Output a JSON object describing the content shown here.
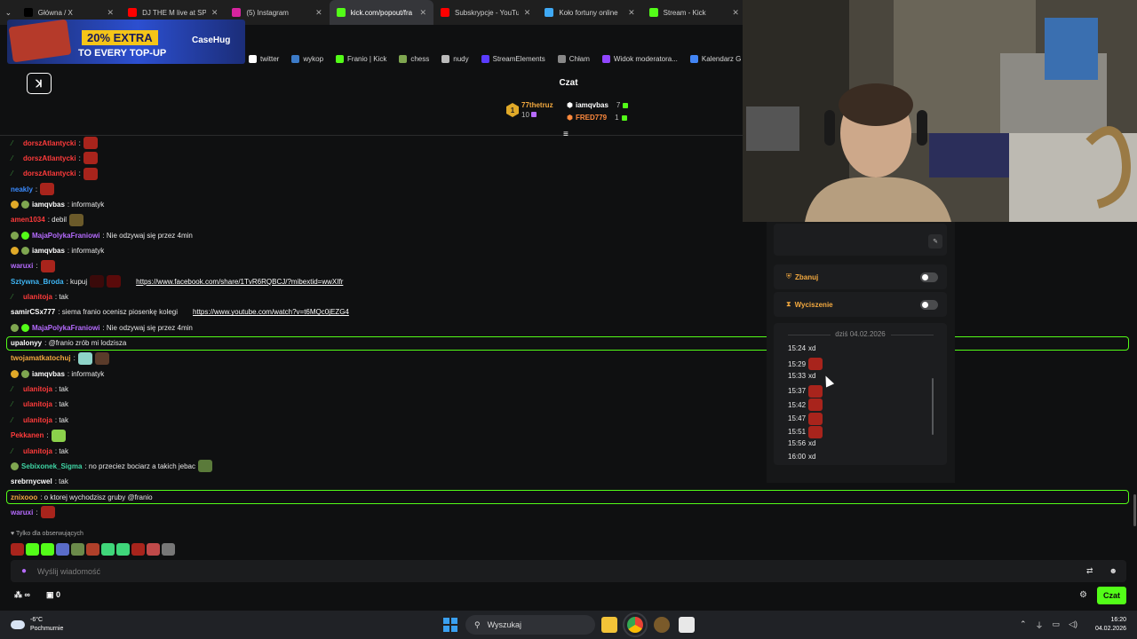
{
  "browser": {
    "tabs": [
      {
        "label": "Główna / X",
        "color": "#000000",
        "active": false
      },
      {
        "label": "DJ THE M live at SPE",
        "color": "#ff0000",
        "active": false
      },
      {
        "label": "(5) Instagram",
        "color": "#d6249f",
        "active": false
      },
      {
        "label": "kick.com/popout/fra",
        "color": "#53fc18",
        "active": true
      },
      {
        "label": "Subskrypcje - YouTu",
        "color": "#ff0000",
        "active": false
      },
      {
        "label": "Koło fortuny online",
        "color": "#3fa9f5",
        "active": false
      },
      {
        "label": "Stream - Kick",
        "color": "#53fc18",
        "active": false
      }
    ],
    "ad": {
      "extra": "20% EXTRA",
      "topup": "TO EVERY TOP-UP",
      "logo": "CaseHug"
    },
    "bookmarks": [
      {
        "label": "twitter",
        "color": "#ffffff"
      },
      {
        "label": "wykop",
        "color": "#3c7bc8"
      },
      {
        "label": "Franio | Kick",
        "color": "#53fc18"
      },
      {
        "label": "chess",
        "color": "#7fa650"
      },
      {
        "label": "nudy",
        "color": "#bbbbbb"
      },
      {
        "label": "StreamElements",
        "color": "#5a3cff"
      },
      {
        "label": "Chłam",
        "color": "#888888"
      },
      {
        "label": "Widok moderatora...",
        "color": "#9146ff"
      },
      {
        "label": "Kalendarz G",
        "color": "#4285f4"
      }
    ]
  },
  "kick": {
    "logo": "ꓘ",
    "chat_title": "Czat",
    "gifters": [
      {
        "rank": "1",
        "name": "77thetruz",
        "count": "10",
        "color": "#f3a93f"
      },
      {
        "name": "iamqvbas",
        "count": "7",
        "color": "#ffffff"
      },
      {
        "name": "FRED779",
        "count": "1",
        "color": "#ff8a3d"
      }
    ]
  },
  "chat": [
    {
      "user": "dorszAtlantycki",
      "color": "#ff3b3b",
      "text": ""
    },
    {
      "user": "dorszAtlantycki",
      "color": "#ff3b3b",
      "text": ""
    },
    {
      "user": "dorszAtlantycki",
      "color": "#ff3b3b",
      "text": ""
    },
    {
      "user": "neakly",
      "color": "#3a8bff",
      "text": ""
    },
    {
      "user": "iamqvbas",
      "color": "#ffffff",
      "text": ": informatyk"
    },
    {
      "user": "amen1034",
      "color": "#ff3b3b",
      "text": ": debil"
    },
    {
      "user": "MajaPolykaFraniowi",
      "color": "#b66bff",
      "text": ": Nie odzywaj się przez 4min"
    },
    {
      "user": "iamqvbas",
      "color": "#ffffff",
      "text": ": informatyk"
    },
    {
      "user": "waruxi",
      "color": "#b66bff",
      "text": ""
    },
    {
      "user": "Sztywna_Broda",
      "color": "#3fb6f5",
      "text": ": kupuj",
      "link": "https://www.facebook.com/share/1TvR6RQBCJ/?mibextid=wwXIfr"
    },
    {
      "user": "ulanitoja",
      "color": "#ff3b3b",
      "text": ": tak"
    },
    {
      "user": "samirCSx777",
      "color": "#ffffff",
      "text": ": siema franio ocenisz piosenkę kolegi",
      "link": "https://www.youtube.com/watch?v=t6MQc0jEZG4"
    },
    {
      "user": "MajaPolykaFraniowi",
      "color": "#b66bff",
      "text": ": Nie odzywaj się przez 4min"
    },
    {
      "user": "upalonyy",
      "color": "#ffffff",
      "text": ": @franio zrób mi lodzisza"
    },
    {
      "user": "twojamatkatochuj",
      "color": "#f3a93f",
      "text": ""
    },
    {
      "user": "iamqvbas",
      "color": "#ffffff",
      "text": ": informatyk"
    },
    {
      "user": "ulanitoja",
      "color": "#ff3b3b",
      "text": ": tak"
    },
    {
      "user": "ulanitoja",
      "color": "#ff3b3b",
      "text": ": tak"
    },
    {
      "user": "ulanitoja",
      "color": "#ff3b3b",
      "text": ": tak"
    },
    {
      "user": "Pekkanen",
      "color": "#ff3b3b",
      "text": ""
    },
    {
      "user": "ulanitoja",
      "color": "#ff3b3b",
      "text": ": tak"
    },
    {
      "user": "Sebixonek_Sigma",
      "color": "#3fd6a5",
      "text": ": no przeciez bociarz a takich jebac"
    },
    {
      "user": "srebrnycwel",
      "color": "#ffffff",
      "text": ": tak"
    },
    {
      "user": "znixooo",
      "color": "#f3a93f",
      "text": ": o ktorej wychodzisz gruby @franio"
    },
    {
      "user": "waruxi",
      "color": "#b66bff",
      "text": ""
    }
  ],
  "composer": {
    "followers_note": "Tylko dla obserwujących",
    "placeholder": "Wyślij wiadomość",
    "viewers": "∞",
    "points": "0",
    "send": "Czat"
  },
  "mod_popup": {
    "ban_label": "Zbanuj",
    "timeout_label": "Wyciszenie",
    "date": "dziś 04.02.2026",
    "history": [
      {
        "time": "15:24",
        "text": "xd"
      },
      {
        "time": "15:29",
        "text": ""
      },
      {
        "time": "15:33",
        "text": "xd"
      },
      {
        "time": "15:37",
        "text": ""
      },
      {
        "time": "15:42",
        "text": ""
      },
      {
        "time": "15:47",
        "text": ""
      },
      {
        "time": "15:51",
        "text": ""
      },
      {
        "time": "15:56",
        "text": "xd"
      },
      {
        "time": "16:00",
        "text": "xd"
      }
    ]
  },
  "taskbar": {
    "temp": "-6°C",
    "weather": "Pochmurnie",
    "search": "Wyszukaj",
    "time": "16:20",
    "date": "04.02.2026"
  }
}
